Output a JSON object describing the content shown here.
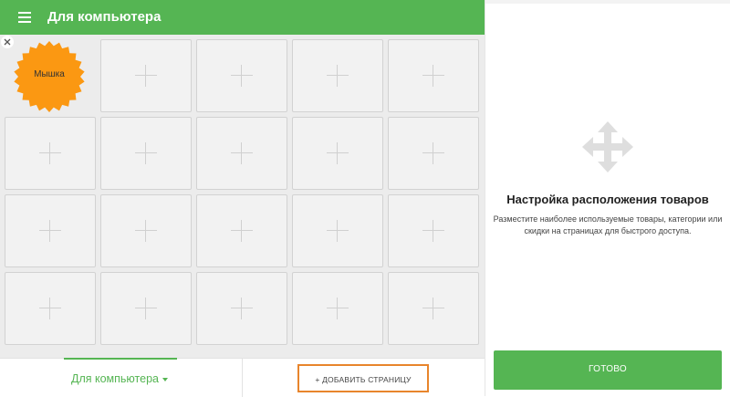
{
  "header": {
    "title": "Для компьютера",
    "menu_icon": "menu-icon"
  },
  "grid": {
    "rows": 4,
    "columns": 5,
    "filled_item": {
      "label": "Мышка",
      "color": "#fb9812",
      "shape": "starburst-badge"
    },
    "empty_cell_icon": "plus-icon"
  },
  "bottom_bar": {
    "page_tab_label": "Для компьютера",
    "add_page_label": "+ ДОБАВИТЬ СТРАНИЦУ"
  },
  "right_panel": {
    "icon": "move-icon",
    "title": "Настройка расположения товаров",
    "description": "Разместите наиболее используемые товары, категории или скидки на страницах для быстрого доступа.",
    "done_label": "ГОТОВО"
  },
  "colors": {
    "accent": "#55b553",
    "highlight": "#e8852c",
    "badge": "#fb9812"
  }
}
